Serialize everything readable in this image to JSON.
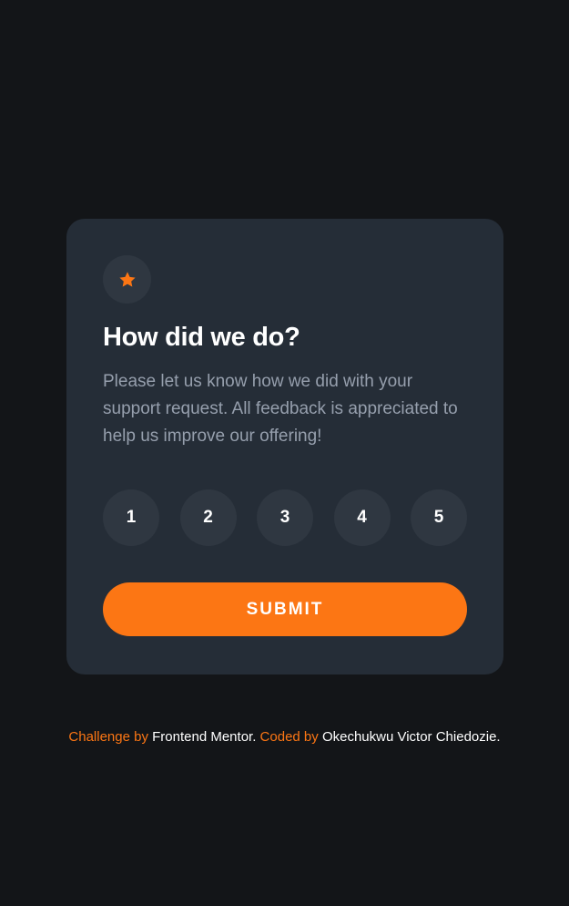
{
  "colors": {
    "page_background": "#131518",
    "card_background": "#252d37",
    "circle_background": "#2f3741",
    "accent": "#fc7614",
    "heading": "#ffffff",
    "body_text": "#969fad"
  },
  "card": {
    "icon": "star-icon",
    "title": "How did we do?",
    "description": "Please let us know how we did with your support request. All feedback is appreciated to help us improve our offering!",
    "ratings": [
      "1",
      "2",
      "3",
      "4",
      "5"
    ],
    "submit_label": "SUBMIT"
  },
  "footer": {
    "challenge_by": "Challenge by",
    "challenge_link": "Frontend Mentor.",
    "coded_by": "Coded by",
    "author_link": "Okechukwu Victor Chiedozie."
  }
}
